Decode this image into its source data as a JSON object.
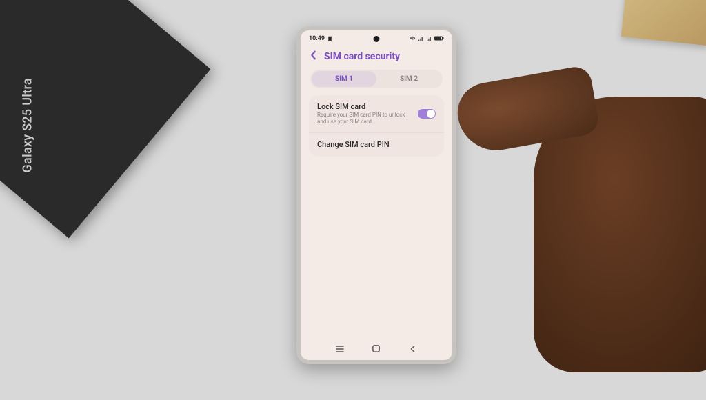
{
  "box": {
    "label": "Galaxy S25 Ultra"
  },
  "status": {
    "time": "10:49"
  },
  "header": {
    "title": "SIM card security"
  },
  "tabs": {
    "sim1": "SIM 1",
    "sim2": "SIM 2",
    "active": "sim1"
  },
  "lock": {
    "title": "Lock SIM card",
    "subtitle": "Require your SIM card PIN to unlock and use your SIM card.",
    "enabled": true
  },
  "changePin": {
    "title": "Change SIM card PIN"
  }
}
